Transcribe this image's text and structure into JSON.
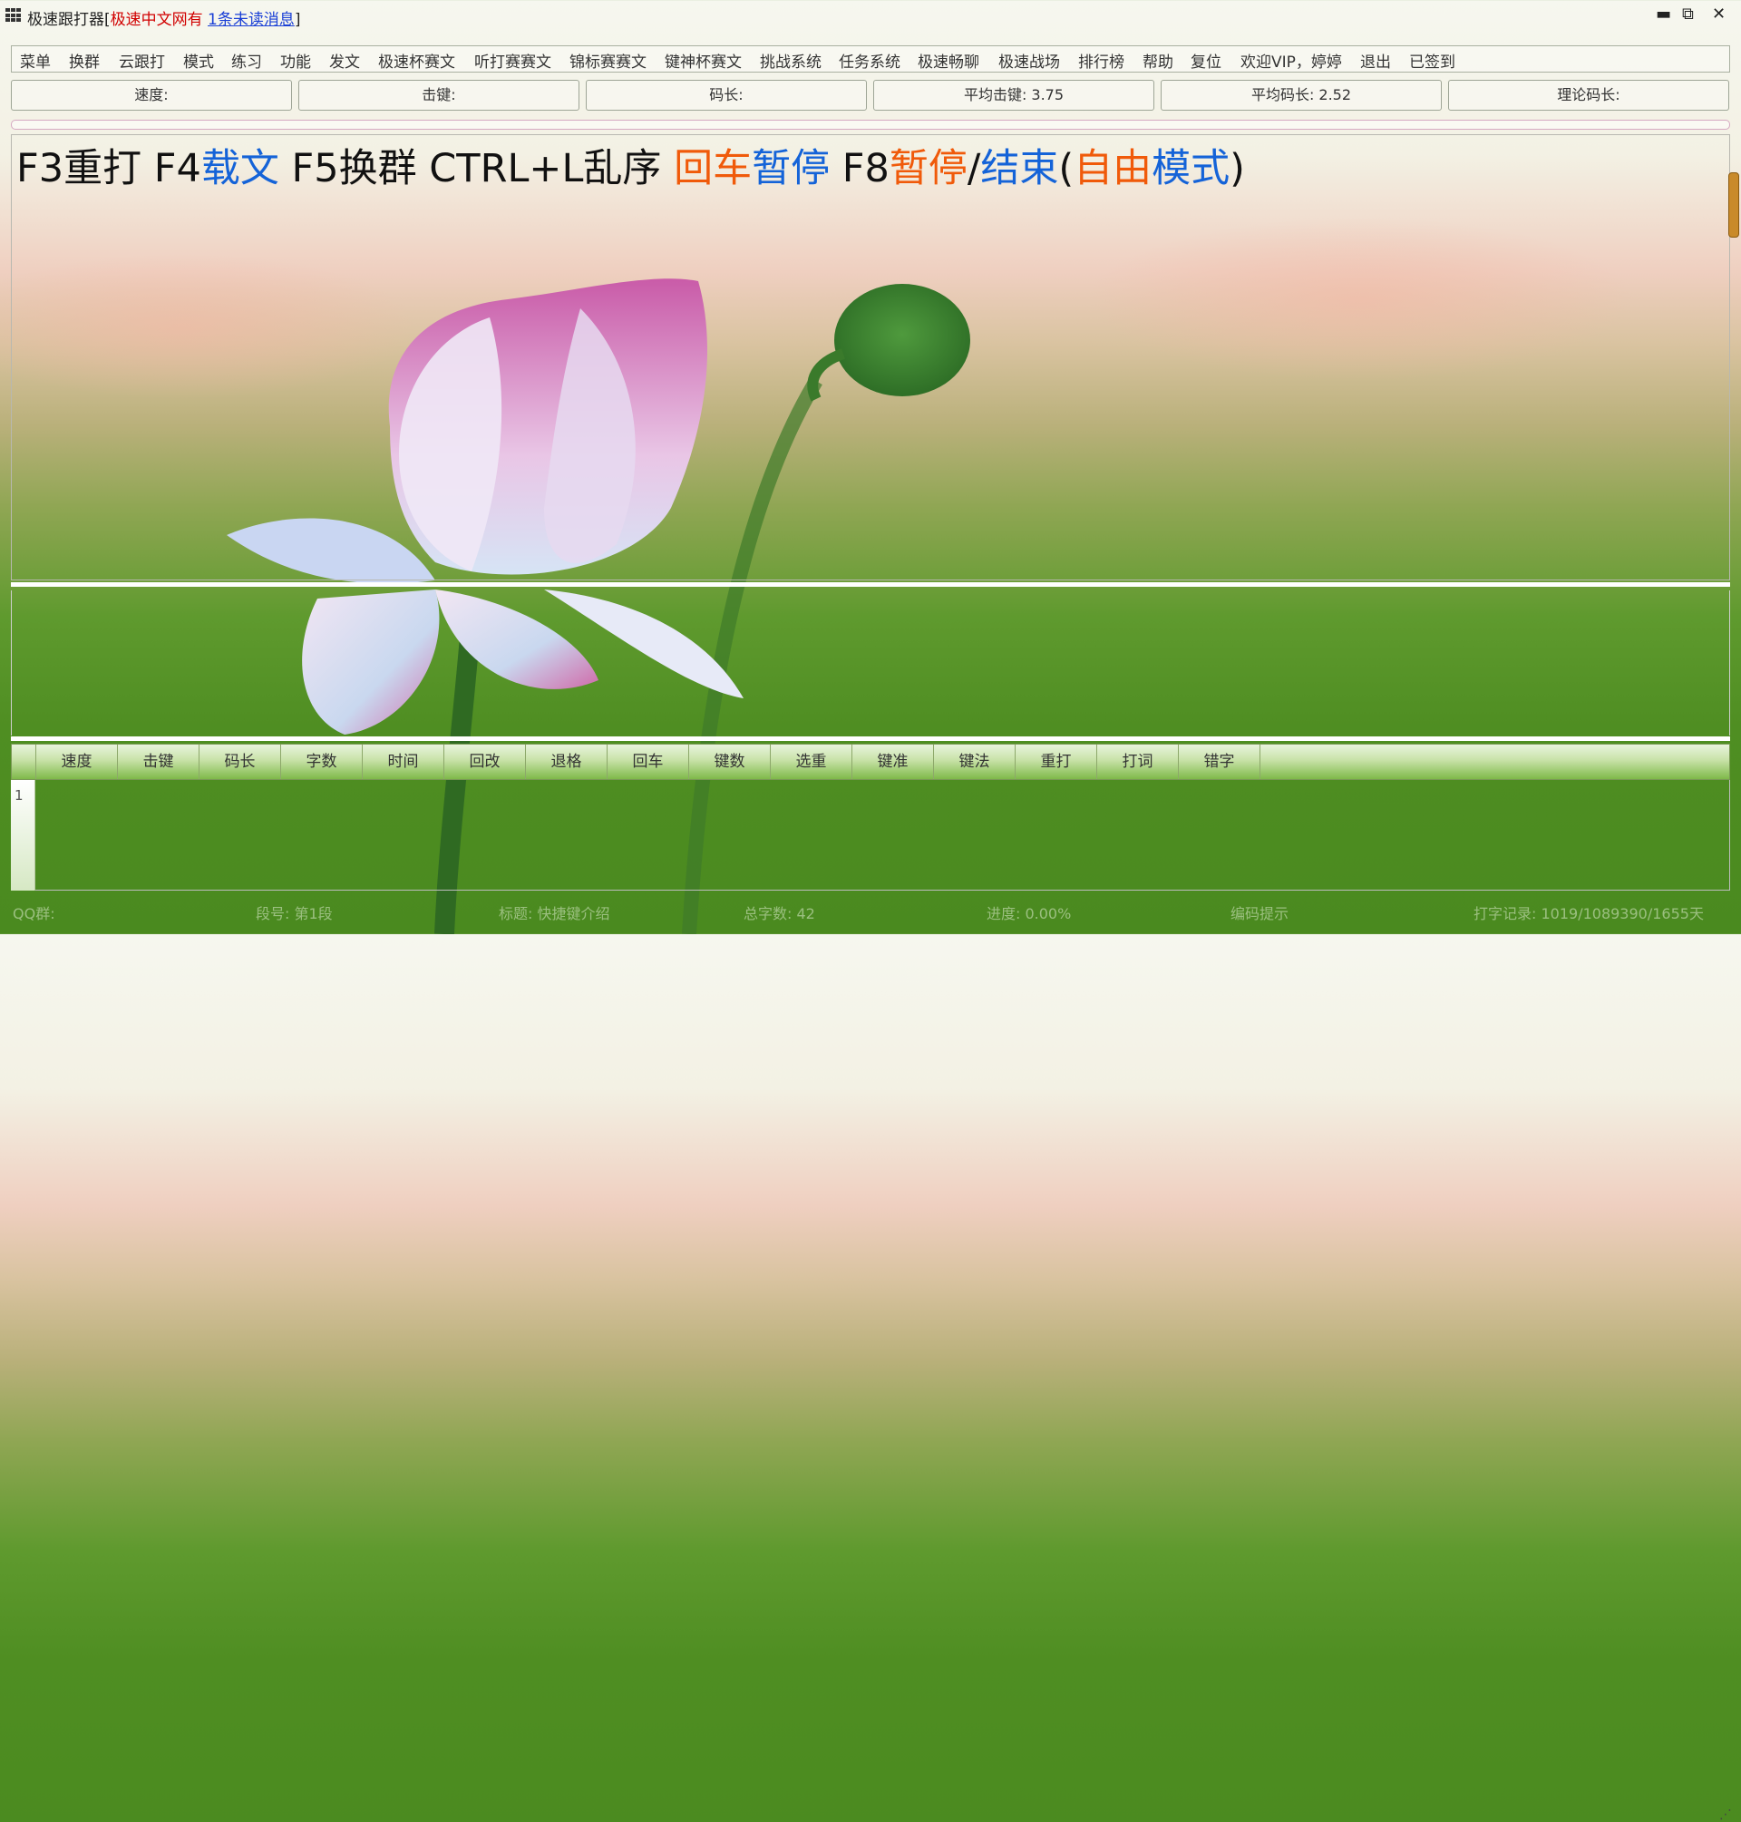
{
  "titlebar": {
    "app_name": "极速跟打器[",
    "site_name": "极速中文网有",
    "unread_link": "1条未读消息",
    "close_bracket": "]",
    "min_glyph": "▬",
    "restore_glyph": "⧉",
    "close_glyph": "✕"
  },
  "menu": [
    "菜单",
    "换群",
    "云跟打",
    "模式",
    "练习",
    "功能",
    "发文",
    "极速杯赛文",
    "听打赛赛文",
    "锦标赛赛文",
    "键神杯赛文",
    "挑战系统",
    "任务系统",
    "极速畅聊",
    "极速战场",
    "排行榜",
    "帮助",
    "复位",
    "欢迎VIP，婷婷",
    "退出",
    "已签到"
  ],
  "stats": [
    "速度:",
    "击键:",
    "码长:",
    "平均击键: 3.75",
    "平均码长: 2.52",
    "理论码长:"
  ],
  "hint": {
    "p1": "F3重打 F4",
    "p2": "载文",
    "p3": " F5换群 CTRL+L乱序 ",
    "p4": "回车",
    "p5": "暂停",
    "p6": " F8",
    "p7": "暂停",
    "p8": "/",
    "p9": "结束",
    "p10": "(",
    "p11": "自由",
    "p12": "模式",
    "p13": ")"
  },
  "grid": {
    "columns": [
      "速度",
      "击键",
      "码长",
      "字数",
      "时间",
      "回改",
      "退格",
      "回车",
      "键数",
      "选重",
      "键准",
      "键法",
      "重打",
      "打词",
      "错字"
    ],
    "rows": [
      "1"
    ]
  },
  "status": {
    "qq_group": "QQ群:",
    "segment": "段号: 第1段",
    "title": "标题: 快捷键介绍",
    "total_chars": "总字数: 42",
    "progress": "进度: 0.00%",
    "code_hint": "编码提示",
    "record": "打字记录: 1019/1089390/1655天"
  },
  "colors": {
    "accent_blue": "#1463d8",
    "accent_orange": "#f05a0a",
    "title_red": "#d10000"
  }
}
